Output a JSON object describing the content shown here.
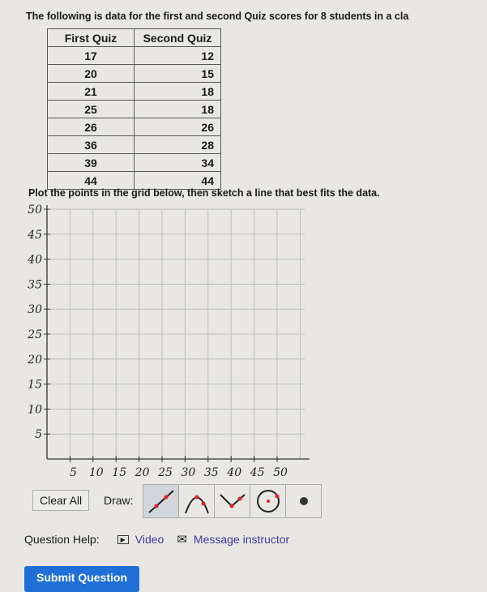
{
  "question": {
    "intro": "The following is data for the first and second Quiz scores for 8 students in a cla",
    "instruction": "Plot the points in the grid below, then sketch a line that best fits the data."
  },
  "table": {
    "headers": [
      "First Quiz",
      "Second Quiz"
    ],
    "rows": [
      [
        "17",
        "12"
      ],
      [
        "20",
        "15"
      ],
      [
        "21",
        "18"
      ],
      [
        "25",
        "18"
      ],
      [
        "26",
        "26"
      ],
      [
        "36",
        "28"
      ],
      [
        "39",
        "34"
      ],
      [
        "44",
        "44"
      ]
    ]
  },
  "graph": {
    "x_ticks": [
      "5",
      "10",
      "15",
      "20",
      "25",
      "30",
      "35",
      "40",
      "45",
      "50"
    ],
    "y_ticks": [
      "50",
      "45",
      "40",
      "35",
      "30",
      "25",
      "20",
      "15",
      "10",
      "5"
    ],
    "xlim": [
      0,
      50
    ],
    "ylim": [
      0,
      50
    ]
  },
  "toolbar": {
    "clear_label": "Clear All",
    "draw_label": "Draw:",
    "tools": [
      "line",
      "parabola",
      "absolute-value",
      "circle",
      "point"
    ],
    "selected": "line"
  },
  "help": {
    "label": "Question Help:",
    "video": "Video",
    "message": "Message instructor"
  },
  "submit_label": "Submit Question",
  "colors": {
    "accent": "#1f6fd6",
    "link": "#3a3a9a",
    "point": "#e0202a"
  }
}
